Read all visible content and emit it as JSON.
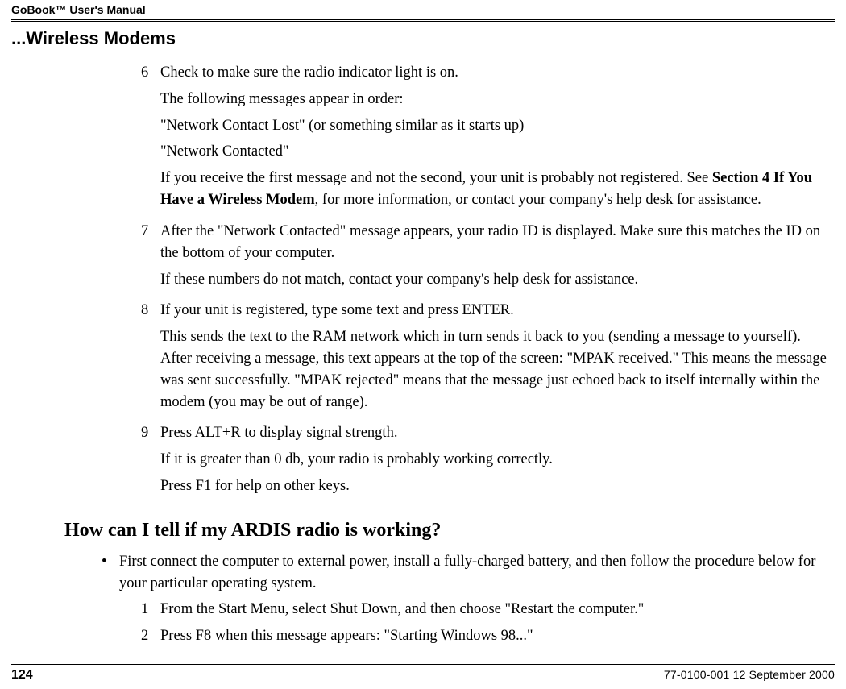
{
  "running_head": "GoBook™ User's Manual",
  "section_title": "...Wireless Modems",
  "steps": [
    {
      "num": "6",
      "paras": [
        "Check to make sure the radio indicator light is on.",
        "The following messages appear in order:",
        "\"Network Contact Lost\" (or something similar as it starts up)",
        "\"Network Contacted\""
      ],
      "rich_para_prefix": "If you receive the first message and not the second, your unit is probably not registered. See ",
      "bold_part": "Section 4 If You Have a Wireless Modem",
      "rich_para_suffix": ", for more information, or contact your company's help desk for assistance."
    },
    {
      "num": "7",
      "paras": [
        "After the \"Network Contacted\" message appears, your radio ID is displayed. Make sure this matches the ID on the bottom of your computer.",
        "If these numbers do not match, contact your company's help desk for assistance."
      ]
    },
    {
      "num": "8",
      "paras": [
        "If your unit is registered, type some text and press ENTER.",
        "This sends the text to the RAM network which in turn sends it back to you (sending a message to yourself). After receiving a message, this text appears at the top of the screen: \"MPAK received.\" This means the message was sent successfully. \"MPAK rejected\" means that the message just echoed back to itself internally within the modem (you may be out of range)."
      ]
    },
    {
      "num": "9",
      "paras": [
        "Press ALT+R to display signal strength.",
        "If it is greater than 0 db, your radio is probably working correctly.",
        "Press F1 for help on other keys."
      ]
    }
  ],
  "heading2": "How can I tell if my ARDIS radio is working?",
  "bullet_text": "First connect the computer to external power, install a fully-charged battery, and then follow the procedure below for your particular operating system.",
  "substeps": [
    {
      "num": "1",
      "text": "From the Start Menu, select Shut Down, and then choose \"Restart the computer.\""
    },
    {
      "num": "2",
      "text": "Press F8 when this message appears: \"Starting Windows 98...\""
    }
  ],
  "footer": {
    "page_num": "124",
    "doc_id": "77-0100-001   12 September 2000"
  }
}
